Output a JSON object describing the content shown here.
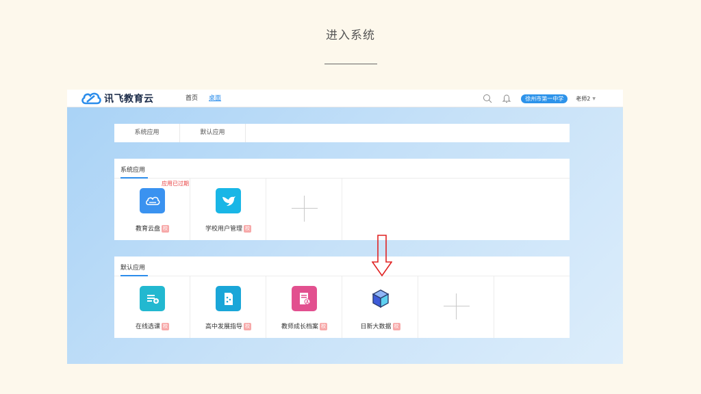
{
  "slide": {
    "title": "进入系统"
  },
  "header": {
    "logo_text": "讯飞教育云",
    "nav": [
      "首页",
      "桌面"
    ],
    "school": "徐州市第一中学",
    "user": "老师2",
    "user_caret": "▼"
  },
  "tabs": [
    "系统应用",
    "默认应用"
  ],
  "sections": [
    {
      "title": "系统应用",
      "apps": [
        {
          "label": "教育云盘",
          "tag": "校",
          "status": "应用已过期",
          "icon": "cloud-drive-icon",
          "color": "#3a92f0"
        },
        {
          "label": "学校用户管理",
          "tag": "校",
          "icon": "bird-icon",
          "color": "#19b6e6"
        }
      ]
    },
    {
      "title": "默认应用",
      "apps": [
        {
          "label": "在线选课",
          "tag": "校",
          "icon": "list-plus-icon",
          "color": "#22b8d0"
        },
        {
          "label": "高中发展指导",
          "tag": "校",
          "icon": "compass-doc-icon",
          "color": "#1aa6d8"
        },
        {
          "label": "教师成长档案",
          "tag": "校",
          "icon": "profile-doc-icon",
          "color": "#e2508f"
        },
        {
          "label": "日新大数据",
          "tag": "校",
          "icon": "cube-icon",
          "color": "#3d5bd9"
        }
      ]
    }
  ],
  "annotation": {
    "icon": "down-arrow-icon",
    "color": "#e02020"
  }
}
